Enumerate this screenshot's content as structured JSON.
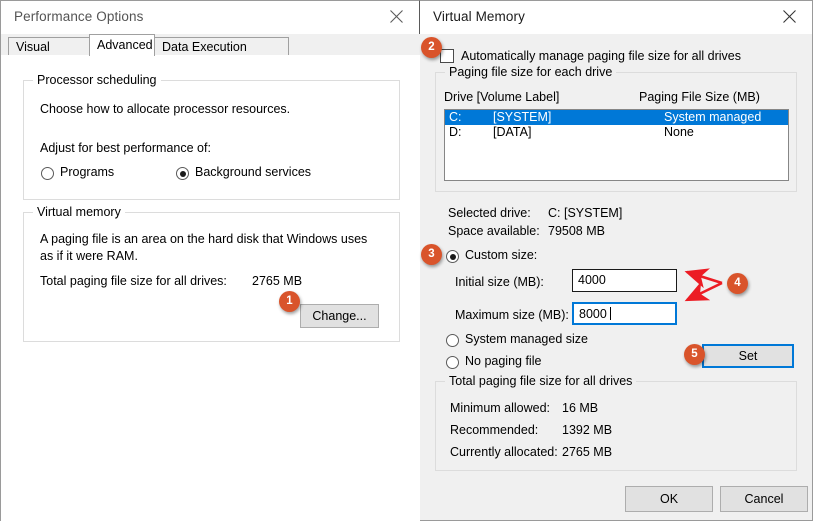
{
  "left_window": {
    "title": "Performance Options",
    "close_icon": "close-icon",
    "tabs": [
      {
        "label": "Visual Effects",
        "active": false
      },
      {
        "label": "Advanced",
        "active": true
      },
      {
        "label": "Data Execution Prevention",
        "active": false
      }
    ],
    "processor_scheduling": {
      "legend": "Processor scheduling",
      "description": "Choose how to allocate processor resources.",
      "prompt": "Adjust for best performance of:",
      "options": [
        {
          "label": "Programs",
          "selected": false
        },
        {
          "label": "Background services",
          "selected": true
        }
      ]
    },
    "virtual_memory": {
      "legend": "Virtual memory",
      "description": "A paging file is an area on the hard disk that Windows uses as if it were RAM.",
      "total_label": "Total paging file size for all drives:",
      "total_value": "2765 MB",
      "change_button": "Change..."
    }
  },
  "right_window": {
    "title": "Virtual Memory",
    "close_icon": "close-icon",
    "auto_manage": {
      "label": "Automatically manage paging file size for all drives",
      "checked": false
    },
    "paging_group": {
      "legend": "Paging file size for each drive",
      "columns": [
        "Drive  [Volume Label]",
        "Paging File Size (MB)"
      ],
      "rows": [
        {
          "drive": "C:",
          "volume": "[SYSTEM]",
          "size": "System managed",
          "selected": true
        },
        {
          "drive": "D:",
          "volume": "[DATA]",
          "size": "None",
          "selected": false
        }
      ]
    },
    "selected_drive_label": "Selected drive:",
    "selected_drive_value": "C:  [SYSTEM]",
    "space_available_label": "Space available:",
    "space_available_value": "79508 MB",
    "size_options": [
      {
        "label": "Custom size:",
        "selected": true
      },
      {
        "label": "System managed size",
        "selected": false
      },
      {
        "label": "No paging file",
        "selected": false
      }
    ],
    "initial_size": {
      "label": "Initial size (MB):",
      "value": "4000",
      "focused": false
    },
    "maximum_size": {
      "label": "Maximum size (MB):",
      "value": "8000",
      "focused": true
    },
    "set_button": {
      "label": "Set",
      "focused": true
    },
    "totals_group": {
      "legend": "Total paging file size for all drives",
      "rows": [
        {
          "label": "Minimum allowed:",
          "value": "16 MB"
        },
        {
          "label": "Recommended:",
          "value": "1392 MB"
        },
        {
          "label": "Currently allocated:",
          "value": "2765 MB"
        }
      ]
    },
    "ok_button": "OK",
    "cancel_button": "Cancel"
  },
  "annotations": {
    "badge_color": "#d9542b",
    "arrow_color": "#ec1c24",
    "badges": [
      {
        "number": "1",
        "target": "change-button"
      },
      {
        "number": "2",
        "target": "auto-manage-checkbox"
      },
      {
        "number": "3",
        "target": "custom-size-radio"
      },
      {
        "number": "4",
        "target": "size-inputs"
      },
      {
        "number": "5",
        "target": "set-button"
      }
    ]
  }
}
